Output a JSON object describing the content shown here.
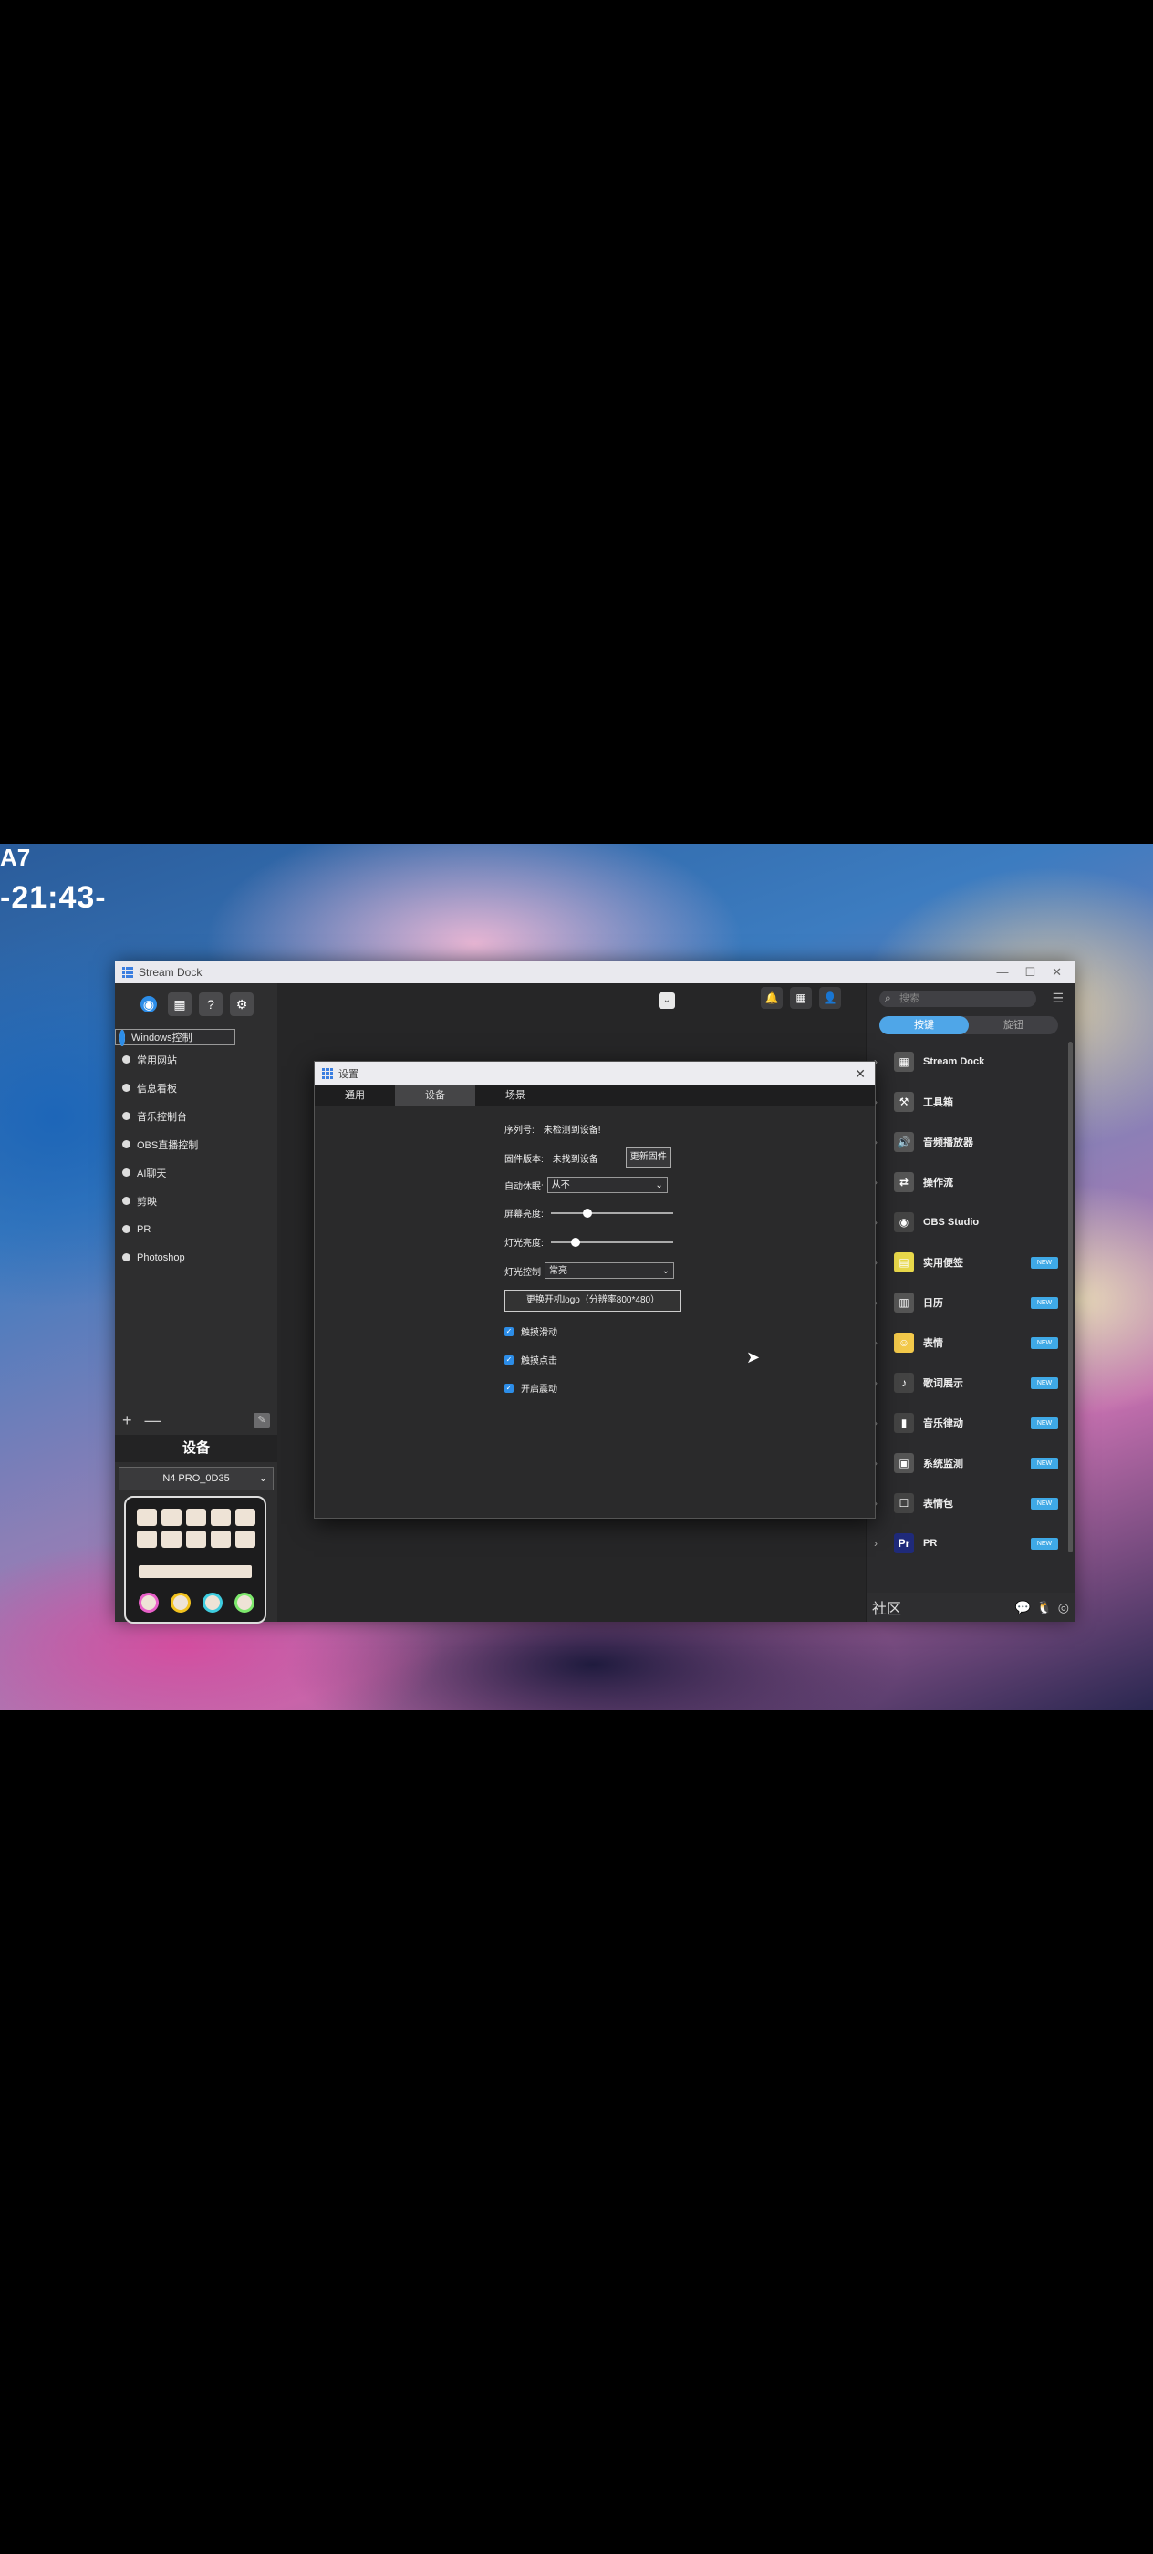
{
  "photo": {
    "clock": "-21:43-",
    "top_text": "A7"
  },
  "window": {
    "title": "Stream Dock"
  },
  "sidebar": {
    "scenes": [
      {
        "label": "Windows控制",
        "selected": true
      },
      {
        "label": "常用网站",
        "selected": false
      },
      {
        "label": "信息看板",
        "selected": false
      },
      {
        "label": "音乐控制台",
        "selected": false
      },
      {
        "label": "OBS直播控制",
        "selected": false
      },
      {
        "label": "AI聊天",
        "selected": false
      },
      {
        "label": "剪映",
        "selected": false
      },
      {
        "label": "PR",
        "selected": false
      },
      {
        "label": "Photoshop",
        "selected": false
      }
    ],
    "add": "+",
    "remove": "—",
    "device_header": "设备",
    "device_name": "N4 PRO_0D35"
  },
  "right_panel": {
    "search_placeholder": "搜索",
    "tabs": [
      {
        "label": "按键",
        "active": true
      },
      {
        "label": "旋钮",
        "active": false
      }
    ],
    "plugins": [
      {
        "name": "Stream Dock",
        "new": false,
        "icon": "keyboard-icon"
      },
      {
        "name": "工具箱",
        "new": false,
        "icon": "toolbox-icon"
      },
      {
        "name": "音频播放器",
        "new": false,
        "icon": "speaker-icon"
      },
      {
        "name": "操作流",
        "new": false,
        "icon": "flow-icon"
      },
      {
        "name": "OBS Studio",
        "new": false,
        "icon": "obs-icon"
      },
      {
        "name": "实用便签",
        "new": true,
        "icon": "note-icon"
      },
      {
        "name": "日历",
        "new": true,
        "icon": "calendar-icon"
      },
      {
        "name": "表情",
        "new": true,
        "icon": "emoji-icon"
      },
      {
        "name": "歌词展示",
        "new": true,
        "icon": "music-icon"
      },
      {
        "name": "音乐律动",
        "new": true,
        "icon": "equalizer-icon"
      },
      {
        "name": "系统监测",
        "new": true,
        "icon": "monitor-icon"
      },
      {
        "name": "表情包",
        "new": true,
        "icon": "sticker-icon"
      },
      {
        "name": "PR",
        "new": true,
        "icon": "premiere-icon"
      }
    ],
    "new_badge": "NEW",
    "community": "社区"
  },
  "dialog": {
    "title": "设置",
    "tabs": [
      {
        "label": "通用",
        "active": false
      },
      {
        "label": "设备",
        "active": true
      },
      {
        "label": "场景",
        "active": false
      }
    ],
    "serial_label": "序列号:",
    "serial_value": "未检测到设备!",
    "firmware_label": "固件版本:",
    "firmware_value": "未找到设备",
    "update_button": "更新固件",
    "auto_sleep_label": "自动休眠:",
    "auto_sleep_value": "从不",
    "screen_brightness_label": "屏幕亮度:",
    "screen_brightness": 0.28,
    "light_brightness_label": "灯光亮度:",
    "light_brightness": 0.18,
    "light_control_label": "灯光控制",
    "light_control_value": "常亮",
    "logo_button": "更换开机logo（分辨率800*480）",
    "checkboxes": [
      {
        "label": "触摸滑动",
        "checked": true
      },
      {
        "label": "触摸点击",
        "checked": true
      },
      {
        "label": "开启震动",
        "checked": true
      }
    ]
  },
  "colors": {
    "accent": "#2c8de8",
    "new_badge": "#3fa9e6"
  }
}
